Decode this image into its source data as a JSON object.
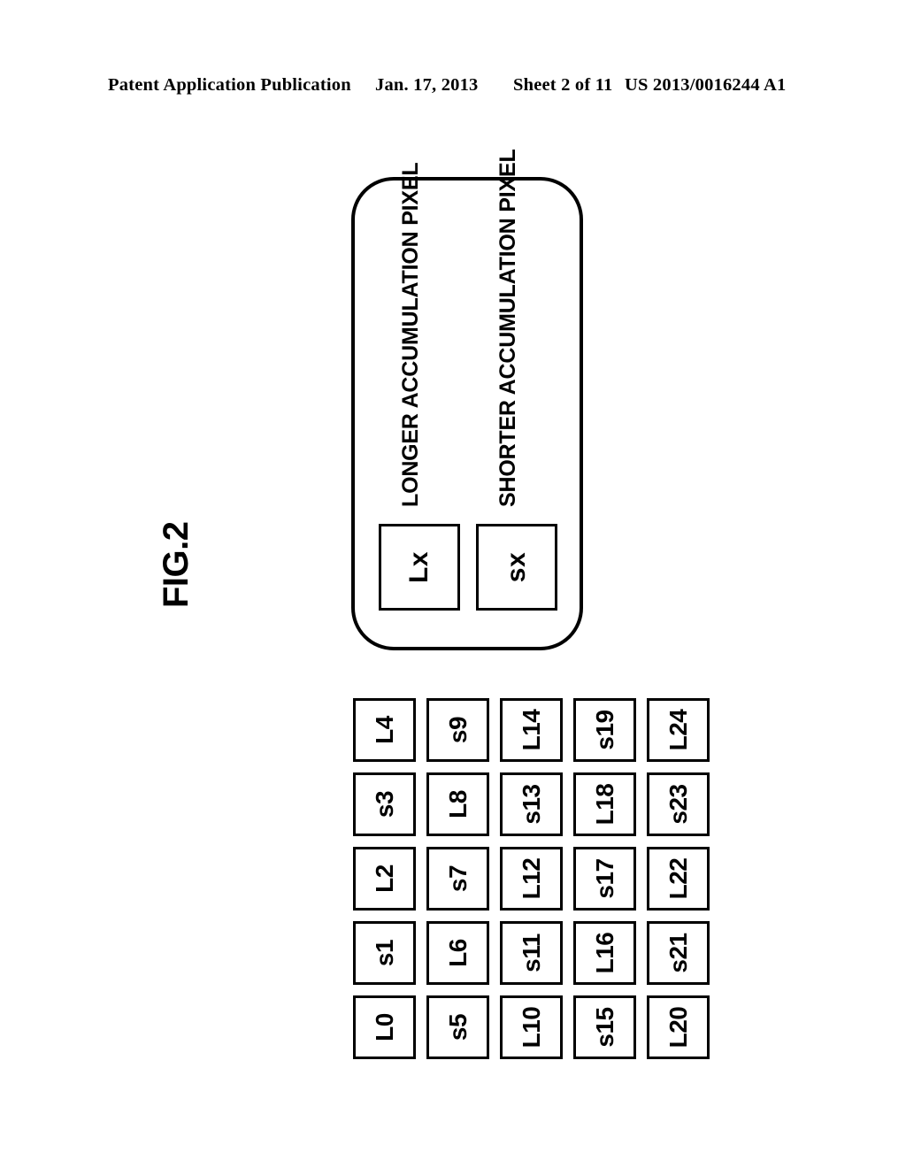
{
  "header": {
    "publication": "Patent Application Publication",
    "date": "Jan. 17, 2013",
    "sheet": "Sheet 2 of 11",
    "doc_number": "US 2013/0016244 A1"
  },
  "figure": {
    "label": "FIG.2"
  },
  "legend": {
    "entries": [
      {
        "swatch": "Lx",
        "caption": "LONGER ACCUMULATION PIXEL"
      },
      {
        "swatch": "sx",
        "caption": "SHORTER ACCUMULATION PIXEL"
      }
    ]
  },
  "pixel_array": {
    "rows": 5,
    "cols": 5,
    "columns_visual": [
      {
        "cells": [
          "L4",
          "s3",
          "L2",
          "s1",
          "L0"
        ]
      },
      {
        "cells": [
          "s9",
          "L8",
          "s7",
          "L6",
          "s5"
        ]
      },
      {
        "cells": [
          "L14",
          "s13",
          "L12",
          "s11",
          "L10"
        ]
      },
      {
        "cells": [
          "s19",
          "L18",
          "s17",
          "L16",
          "s15"
        ]
      },
      {
        "cells": [
          "L24",
          "s23",
          "L22",
          "s21",
          "L20"
        ]
      }
    ],
    "logical_rows": [
      [
        "L0",
        "s1",
        "L2",
        "s3",
        "L4"
      ],
      [
        "s5",
        "L6",
        "s7",
        "L8",
        "s9"
      ],
      [
        "L10",
        "s11",
        "L12",
        "s13",
        "L14"
      ],
      [
        "s15",
        "L16",
        "s17",
        "L18",
        "s19"
      ],
      [
        "L20",
        "s21",
        "L22",
        "s23",
        "L24"
      ]
    ]
  },
  "colors": {
    "ink": "#000000",
    "paper": "#ffffff"
  }
}
